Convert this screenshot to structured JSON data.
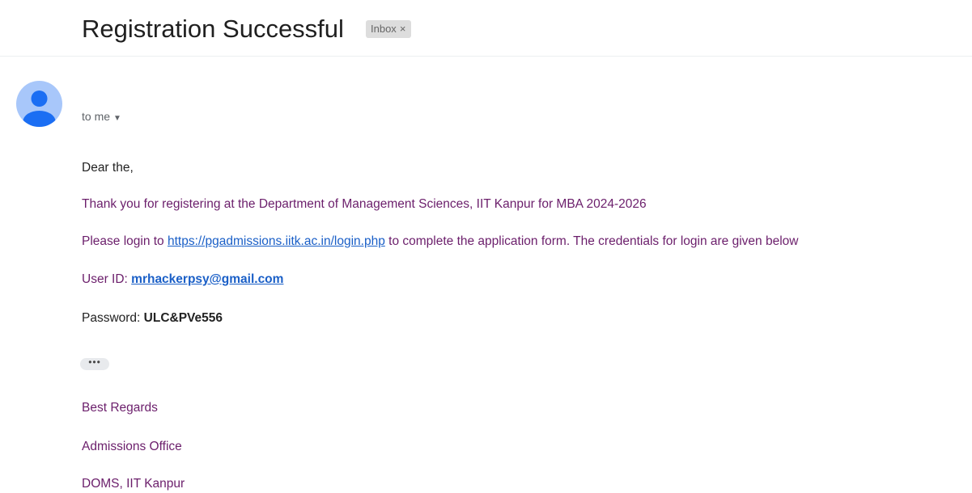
{
  "email": {
    "subject": "Registration Successful",
    "label": "Inbox",
    "label_close": "×",
    "recipient": "to me",
    "recipient_caret": "▼",
    "body": {
      "greeting": "Dear the,",
      "thank_you": "Thank you for registering at the Department of Management Sciences, IIT Kanpur for MBA 2024-2026",
      "login_prefix": "Please login to ",
      "login_url": "https://pgadmissions.iitk.ac.in/login.php",
      "login_suffix": " to complete the application form. The credentials for login are given below",
      "user_id_label": "User ID: ",
      "user_id_value": "mrhackerpsy@gmail.com",
      "password_label": "Password: ",
      "password_value": "ULC&PVe556",
      "trimmed_content": "•••",
      "signoff": "Best Regards",
      "sender_office": "Admissions Office",
      "sender_org": "DOMS, IIT Kanpur"
    }
  },
  "colors": {
    "link": "#1a5fc7",
    "body_accent": "#6b1e6b",
    "avatar_bg": "#a8c7fa",
    "avatar_fg": "#1b6ef3"
  },
  "icons": {
    "avatar": "person-icon",
    "dropdown": "chevron-down-icon"
  }
}
